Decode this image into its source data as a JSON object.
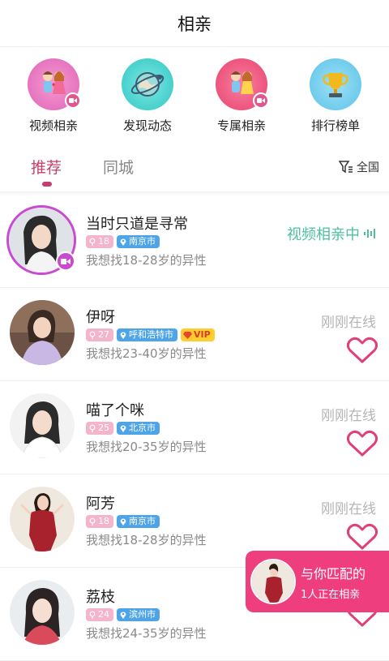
{
  "header": {
    "title": "相亲"
  },
  "quick_entries": [
    {
      "label": "视频相亲",
      "icon": "couple-video-icon"
    },
    {
      "label": "发现动态",
      "icon": "globe-discover-icon"
    },
    {
      "label": "专属相亲",
      "icon": "couple-exclusive-icon"
    },
    {
      "label": "排行榜单",
      "icon": "trophy-icon"
    }
  ],
  "tabs": [
    {
      "label": "推荐",
      "active": true
    },
    {
      "label": "同城",
      "active": false
    }
  ],
  "filter": {
    "label": "全国",
    "icon": "filter-icon"
  },
  "users": [
    {
      "name": "当时只道是寻常",
      "age": "18",
      "city": "南京市",
      "seek": "我想找18-28岁的异性",
      "status": "视频相亲中",
      "live": true
    },
    {
      "name": "伊呀",
      "age": "27",
      "city": "呼和浩特市",
      "vip": "VIP",
      "seek": "我想找23-40岁的异性",
      "status": "刚刚在线"
    },
    {
      "name": "喵了个咪",
      "age": "25",
      "city": "北京市",
      "seek": "我想找20-35岁的异性",
      "status": "刚刚在线"
    },
    {
      "name": "阿芳",
      "age": "18",
      "city": "南京市",
      "seek": "我想找18-28岁的异性",
      "status": "刚刚在线"
    },
    {
      "name": "荔枝",
      "age": "24",
      "city": "滨州市",
      "seek": "我想找24-35岁的异性",
      "status": ""
    }
  ],
  "match_popup": {
    "line1": "与你匹配的",
    "line2": "1人正在相亲"
  },
  "colors": {
    "accent": "#c2406f",
    "live": "#4fc0a0",
    "popup": "#ef3e7e",
    "city_tag": "#4ea4e6",
    "age_tag": "#f4b4cb"
  }
}
